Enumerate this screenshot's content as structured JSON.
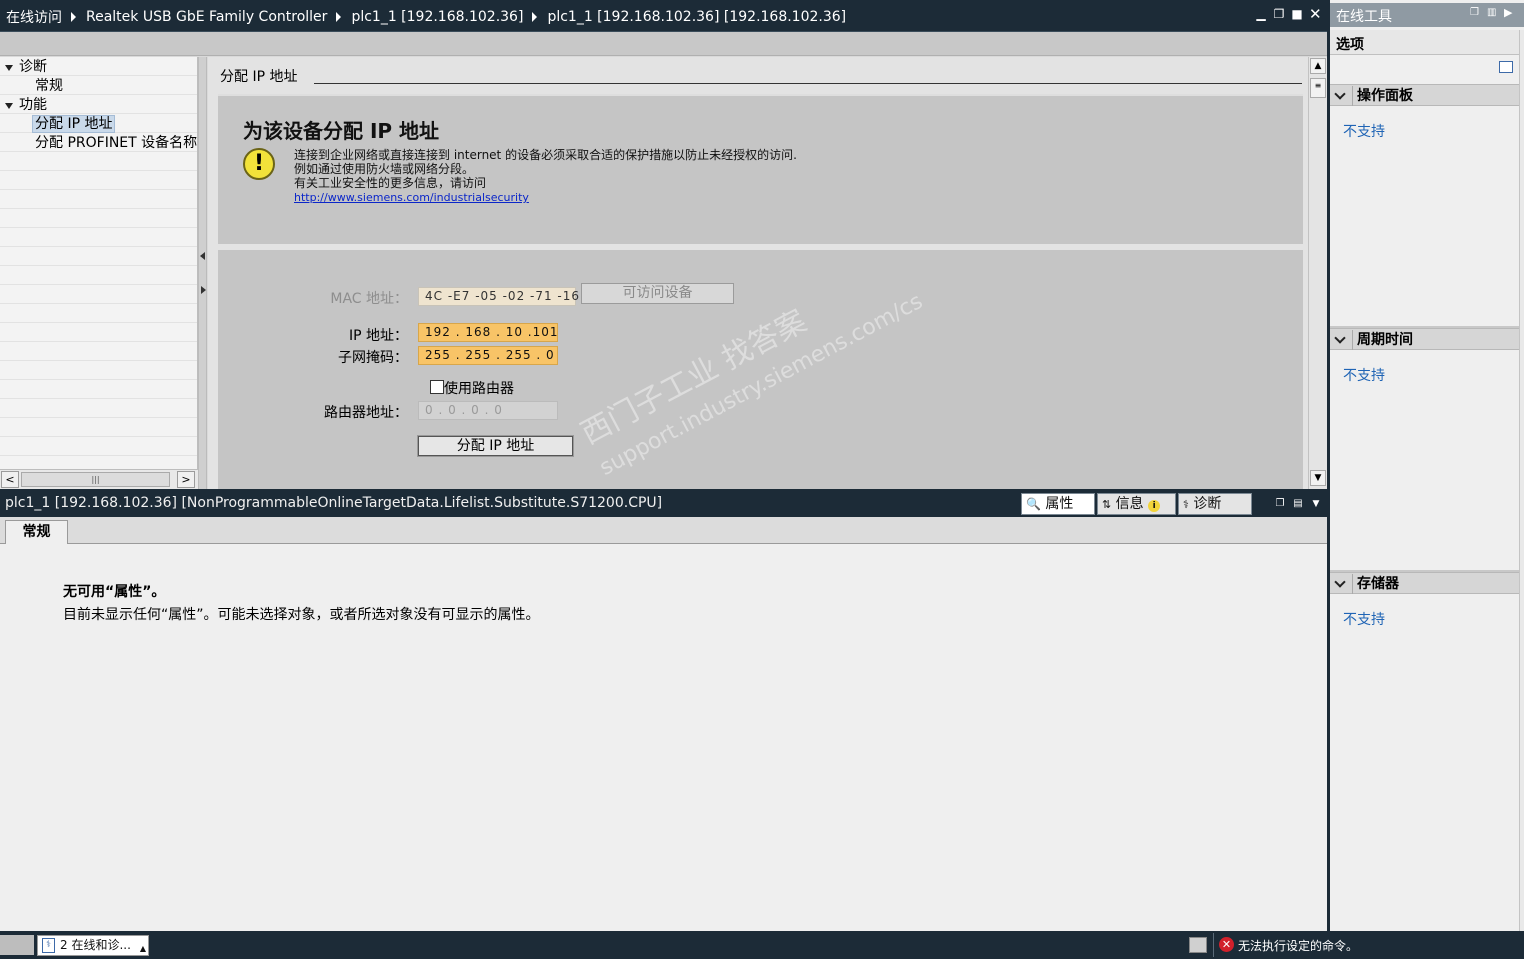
{
  "titlebar": {
    "crumbs": [
      "在线访问",
      "Realtek USB GbE Family Controller",
      "plc1_1 [192.168.102.36]",
      "plc1_1 [192.168.102.36] [192.168.102.36]"
    ]
  },
  "tree": {
    "items": [
      {
        "label": "诊断",
        "expanded": true
      },
      {
        "label": "常规"
      },
      {
        "label": "功能",
        "expanded": true
      },
      {
        "label": "分配 IP 地址",
        "selected": true
      },
      {
        "label": "分配 PROFINET 设备名称"
      }
    ]
  },
  "section": {
    "title": "分配 IP 地址"
  },
  "security": {
    "title": "为该设备分配 IP 地址",
    "line1": "连接到企业网络或直接连接到 internet 的设备必须采取合适的保护措施以防止未经授权的访问.",
    "line2": "例如通过使用防火墙或网络分段。",
    "line3": "有关工业安全性的更多信息，请访问",
    "link": "http://www.siemens.com/industrialsecurity"
  },
  "form": {
    "mac_label": "MAC 地址：",
    "mac_value": "4C -E7 -05 -02 -71 -16",
    "accessible_button": "可访问设备",
    "ip_label": "IP 地址：",
    "ip_value": "192 . 168 . 10   .101",
    "subnet_label": "子网掩码：",
    "subnet_value": "255 . 255 . 255 . 0",
    "router_checkbox": "使用路由器",
    "router_checked": false,
    "router_label": "路由器地址：",
    "router_value": "0   . 0   . 0   . 0",
    "assign_button": "分配 IP 地址"
  },
  "inspector": {
    "path": "plc1_1  [192.168.102.36]  [NonProgrammableOnlineTargetData.Lifelist.Substitute.S71200.CPU]",
    "tabs": [
      "属性",
      "信息",
      "诊断"
    ],
    "subtab": "常规",
    "heading": "无可用“属性”。",
    "desc": "目前未显示任何“属性”。可能未选择对象，或者所选对象没有可显示的属性。"
  },
  "right_panel": {
    "title": "在线工具",
    "options": "选项",
    "sections": [
      {
        "title": "操作面板",
        "value": "不支持"
      },
      {
        "title": "周期时间",
        "value": "不支持"
      },
      {
        "title": "存储器",
        "value": "不支持"
      }
    ]
  },
  "statusbar": {
    "task": "2 在线和诊...",
    "message": "无法执行设定的命令。"
  },
  "watermark": {
    "line1": "西门子工业   找答案",
    "line2": "support.industry.siemens.com/cs"
  },
  "colors": {
    "titlebar": "#1c2b37",
    "field_highlight": "#f8c467",
    "link": "#0b26c9",
    "not_supported": "#1f64b5",
    "error": "#d2202b"
  }
}
